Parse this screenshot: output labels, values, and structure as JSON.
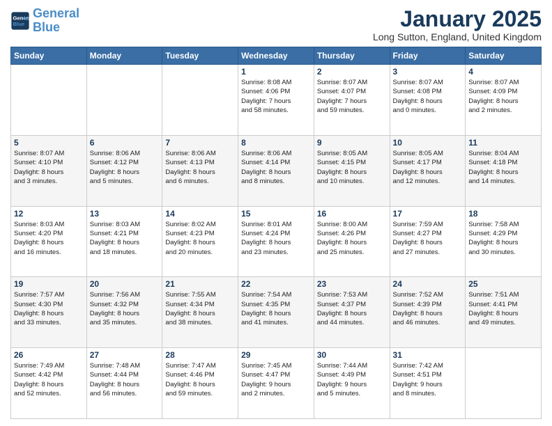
{
  "header": {
    "logo_line1": "General",
    "logo_line2": "Blue",
    "month": "January 2025",
    "location": "Long Sutton, England, United Kingdom"
  },
  "weekdays": [
    "Sunday",
    "Monday",
    "Tuesday",
    "Wednesday",
    "Thursday",
    "Friday",
    "Saturday"
  ],
  "weeks": [
    [
      {
        "day": "",
        "info": ""
      },
      {
        "day": "",
        "info": ""
      },
      {
        "day": "",
        "info": ""
      },
      {
        "day": "1",
        "info": "Sunrise: 8:08 AM\nSunset: 4:06 PM\nDaylight: 7 hours\nand 58 minutes."
      },
      {
        "day": "2",
        "info": "Sunrise: 8:07 AM\nSunset: 4:07 PM\nDaylight: 7 hours\nand 59 minutes."
      },
      {
        "day": "3",
        "info": "Sunrise: 8:07 AM\nSunset: 4:08 PM\nDaylight: 8 hours\nand 0 minutes."
      },
      {
        "day": "4",
        "info": "Sunrise: 8:07 AM\nSunset: 4:09 PM\nDaylight: 8 hours\nand 2 minutes."
      }
    ],
    [
      {
        "day": "5",
        "info": "Sunrise: 8:07 AM\nSunset: 4:10 PM\nDaylight: 8 hours\nand 3 minutes."
      },
      {
        "day": "6",
        "info": "Sunrise: 8:06 AM\nSunset: 4:12 PM\nDaylight: 8 hours\nand 5 minutes."
      },
      {
        "day": "7",
        "info": "Sunrise: 8:06 AM\nSunset: 4:13 PM\nDaylight: 8 hours\nand 6 minutes."
      },
      {
        "day": "8",
        "info": "Sunrise: 8:06 AM\nSunset: 4:14 PM\nDaylight: 8 hours\nand 8 minutes."
      },
      {
        "day": "9",
        "info": "Sunrise: 8:05 AM\nSunset: 4:15 PM\nDaylight: 8 hours\nand 10 minutes."
      },
      {
        "day": "10",
        "info": "Sunrise: 8:05 AM\nSunset: 4:17 PM\nDaylight: 8 hours\nand 12 minutes."
      },
      {
        "day": "11",
        "info": "Sunrise: 8:04 AM\nSunset: 4:18 PM\nDaylight: 8 hours\nand 14 minutes."
      }
    ],
    [
      {
        "day": "12",
        "info": "Sunrise: 8:03 AM\nSunset: 4:20 PM\nDaylight: 8 hours\nand 16 minutes."
      },
      {
        "day": "13",
        "info": "Sunrise: 8:03 AM\nSunset: 4:21 PM\nDaylight: 8 hours\nand 18 minutes."
      },
      {
        "day": "14",
        "info": "Sunrise: 8:02 AM\nSunset: 4:23 PM\nDaylight: 8 hours\nand 20 minutes."
      },
      {
        "day": "15",
        "info": "Sunrise: 8:01 AM\nSunset: 4:24 PM\nDaylight: 8 hours\nand 23 minutes."
      },
      {
        "day": "16",
        "info": "Sunrise: 8:00 AM\nSunset: 4:26 PM\nDaylight: 8 hours\nand 25 minutes."
      },
      {
        "day": "17",
        "info": "Sunrise: 7:59 AM\nSunset: 4:27 PM\nDaylight: 8 hours\nand 27 minutes."
      },
      {
        "day": "18",
        "info": "Sunrise: 7:58 AM\nSunset: 4:29 PM\nDaylight: 8 hours\nand 30 minutes."
      }
    ],
    [
      {
        "day": "19",
        "info": "Sunrise: 7:57 AM\nSunset: 4:30 PM\nDaylight: 8 hours\nand 33 minutes."
      },
      {
        "day": "20",
        "info": "Sunrise: 7:56 AM\nSunset: 4:32 PM\nDaylight: 8 hours\nand 35 minutes."
      },
      {
        "day": "21",
        "info": "Sunrise: 7:55 AM\nSunset: 4:34 PM\nDaylight: 8 hours\nand 38 minutes."
      },
      {
        "day": "22",
        "info": "Sunrise: 7:54 AM\nSunset: 4:35 PM\nDaylight: 8 hours\nand 41 minutes."
      },
      {
        "day": "23",
        "info": "Sunrise: 7:53 AM\nSunset: 4:37 PM\nDaylight: 8 hours\nand 44 minutes."
      },
      {
        "day": "24",
        "info": "Sunrise: 7:52 AM\nSunset: 4:39 PM\nDaylight: 8 hours\nand 46 minutes."
      },
      {
        "day": "25",
        "info": "Sunrise: 7:51 AM\nSunset: 4:41 PM\nDaylight: 8 hours\nand 49 minutes."
      }
    ],
    [
      {
        "day": "26",
        "info": "Sunrise: 7:49 AM\nSunset: 4:42 PM\nDaylight: 8 hours\nand 52 minutes."
      },
      {
        "day": "27",
        "info": "Sunrise: 7:48 AM\nSunset: 4:44 PM\nDaylight: 8 hours\nand 56 minutes."
      },
      {
        "day": "28",
        "info": "Sunrise: 7:47 AM\nSunset: 4:46 PM\nDaylight: 8 hours\nand 59 minutes."
      },
      {
        "day": "29",
        "info": "Sunrise: 7:45 AM\nSunset: 4:47 PM\nDaylight: 9 hours\nand 2 minutes."
      },
      {
        "day": "30",
        "info": "Sunrise: 7:44 AM\nSunset: 4:49 PM\nDaylight: 9 hours\nand 5 minutes."
      },
      {
        "day": "31",
        "info": "Sunrise: 7:42 AM\nSunset: 4:51 PM\nDaylight: 9 hours\nand 8 minutes."
      },
      {
        "day": "",
        "info": ""
      }
    ]
  ]
}
